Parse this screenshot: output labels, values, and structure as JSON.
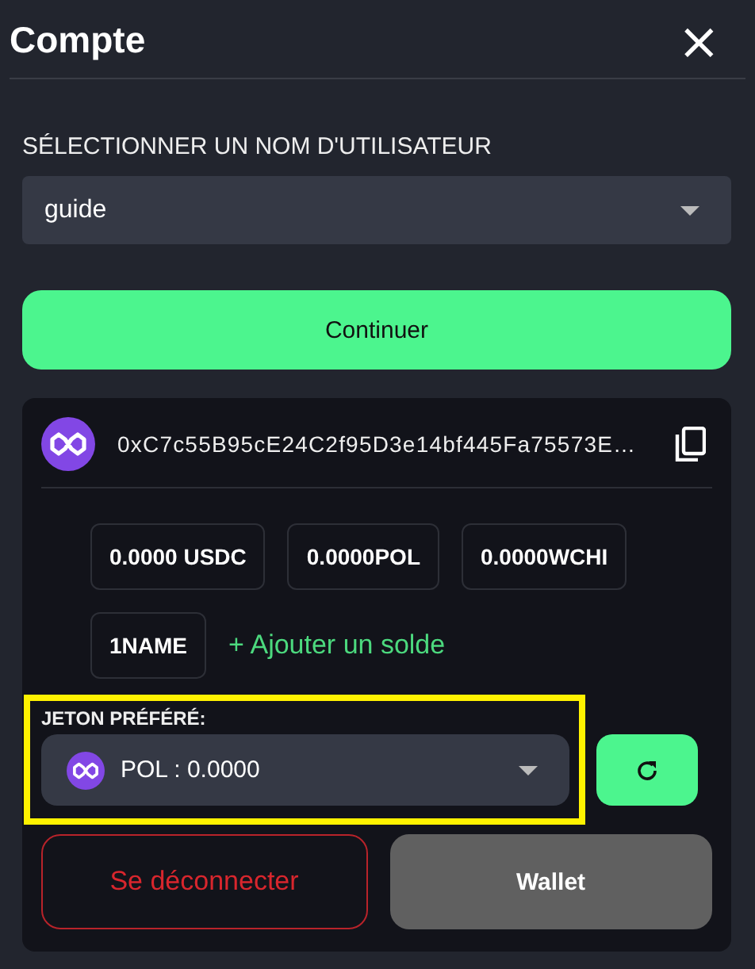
{
  "header": {
    "title": "Compte",
    "close": "×"
  },
  "username": {
    "label": "SÉLECTIONNER UN NOM D'UTILISATEUR",
    "value": "guide"
  },
  "continue_button": "Continuer",
  "wallet": {
    "address": "0xC7c55B95cE24C2f95D3e14bf445Fa75573E…",
    "balances": [
      "0.0000 USDC",
      "0.0000POL",
      "0.0000WCHI",
      "1NAME"
    ],
    "add_balance": "+ Ajouter un solde",
    "preferred_token": {
      "label": "JETON PRÉFÉRÉ:",
      "value": "POL : 0.0000"
    },
    "buttons": [
      {
        "label": "Se déconnecter",
        "kind": "danger"
      },
      {
        "label": "Wallet",
        "kind": "neutral"
      }
    ]
  }
}
